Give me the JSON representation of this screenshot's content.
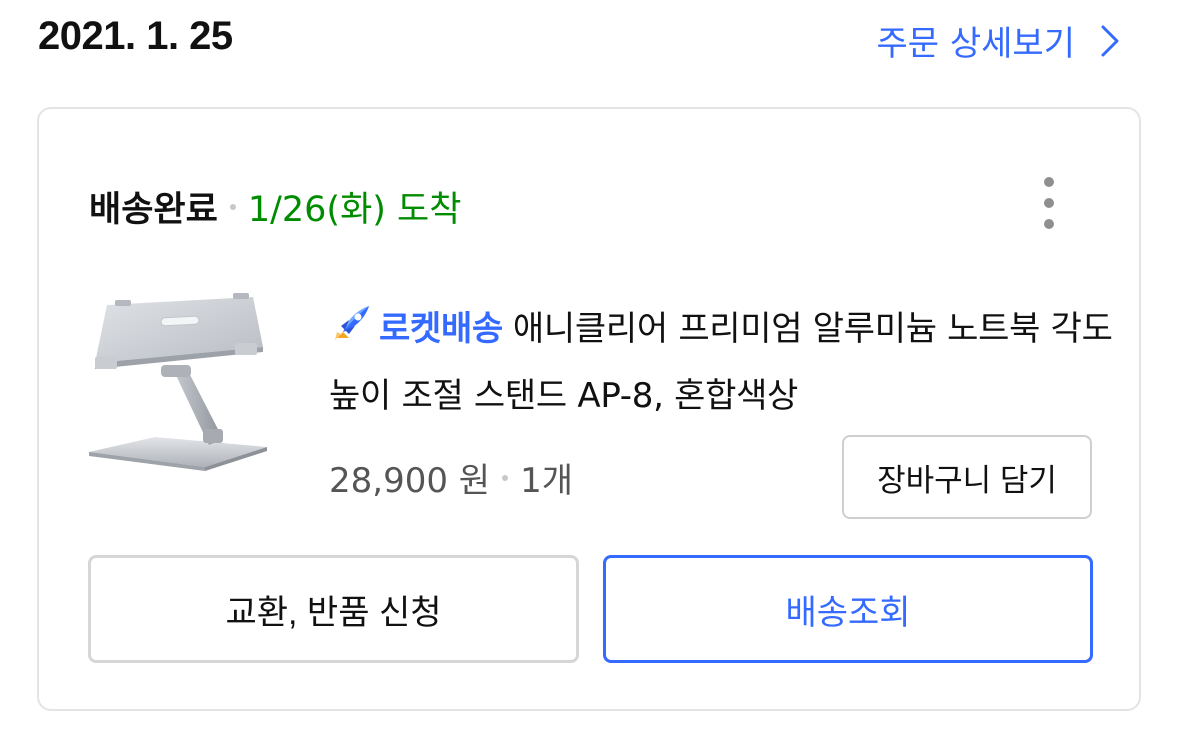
{
  "order": {
    "date": "2021. 1. 25",
    "detail_link_label": "주문 상세보기"
  },
  "shipment": {
    "status": "배송완료",
    "arrival": "1/26(화) 도착"
  },
  "product": {
    "badge_label": "로켓배송",
    "name": "애니클리어 프리미엄 알루미늄 노트북 각도 높이 조절 스탠드 AP-8, 혼합색상",
    "price": "28,900 원",
    "quantity": "1개",
    "image_icon": "laptop-stand-image"
  },
  "actions": {
    "cart_label": "장바구니 담기",
    "return_label": "교환, 반품 신청",
    "track_label": "배송조회"
  },
  "colors": {
    "link_blue": "#346aff",
    "arrival_green": "#008c00",
    "text_dark": "#111111",
    "text_gray": "#555555"
  }
}
